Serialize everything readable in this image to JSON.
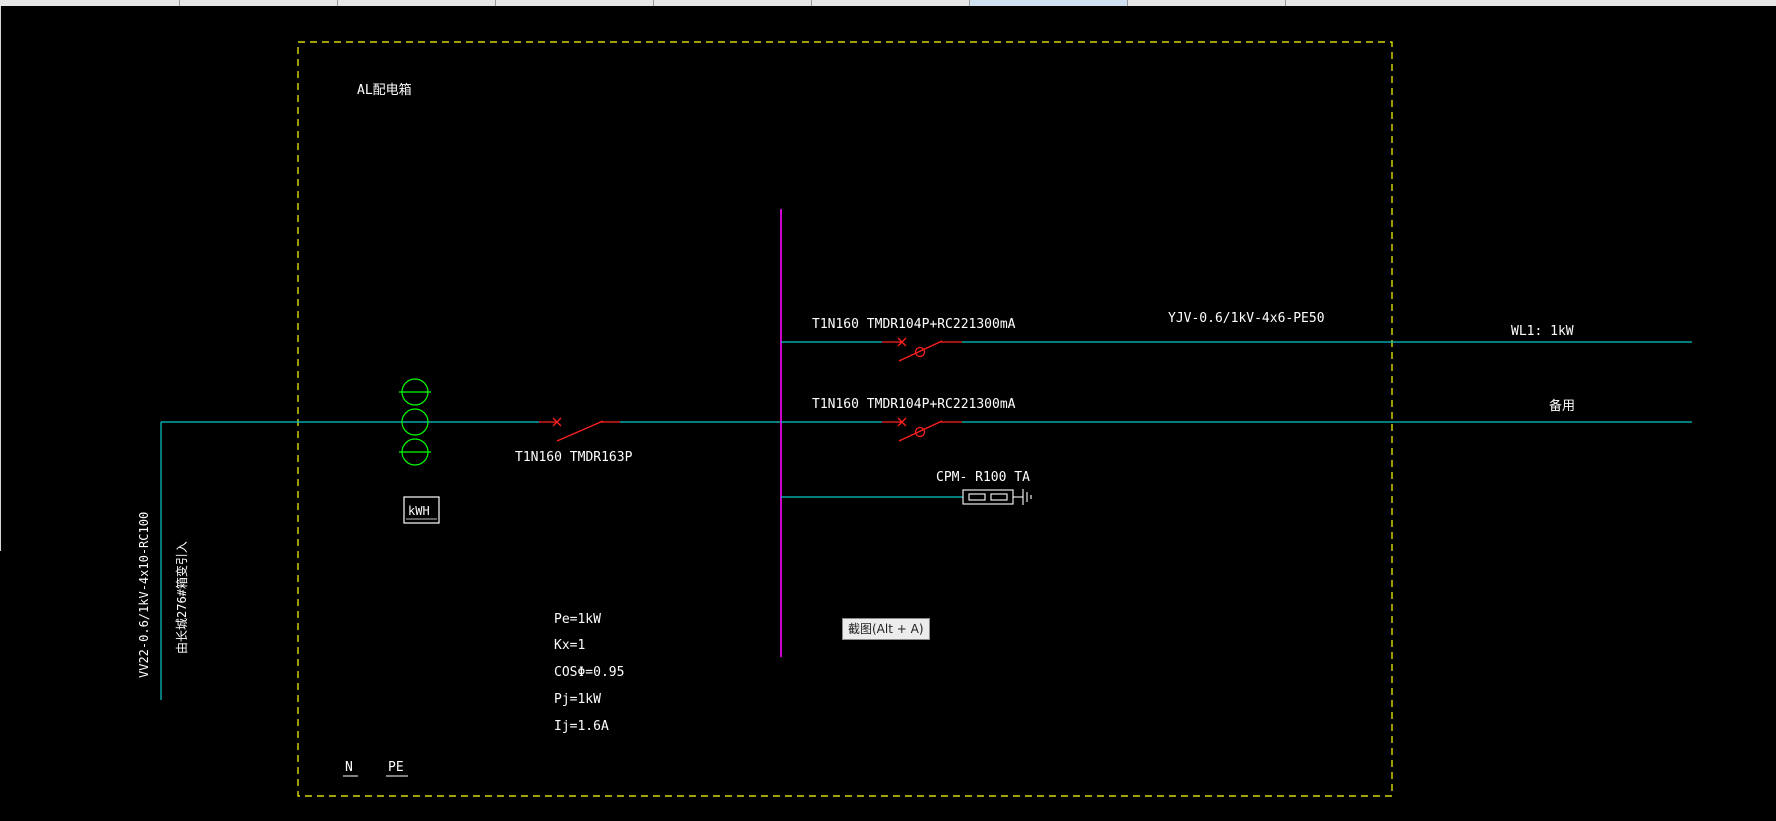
{
  "colors": {
    "background": "#000000",
    "frame": "#ffff00",
    "busbar": "#cc00cc",
    "line": "#00c8c8",
    "breaker": "#ff2020",
    "meter": "#00ff00",
    "text": "#ffffff"
  },
  "diagram": {
    "panel_title": "AL配电箱",
    "incoming": {
      "cable_label": "VV22-0.6/1kV-4x10-RC100",
      "source_label": "由长城276#箱变引入",
      "main_breaker_label": "T1N160 TMDR163P",
      "meter_label": "kWH"
    },
    "load_calc": {
      "pe": "Pe=1kW",
      "kx": "Kx=1",
      "cos": "COSΦ=0.95",
      "pj": "Pj=1kW",
      "ij": "Ij=1.6A"
    },
    "feeders": [
      {
        "breaker_label": "T1N160 TMDR104P+RC221300mA",
        "cable_label": "YJV-0.6/1kV-4x6-PE50",
        "circuit_label": "WL1: 1kW"
      },
      {
        "breaker_label": "T1N160 TMDR104P+RC221300mA",
        "circuit_label": "备用"
      }
    ],
    "spd": {
      "label": "CPM- R100 TA"
    },
    "bus_labels": {
      "n": "N",
      "pe": "PE"
    }
  },
  "tooltip": {
    "text": "截图(Alt + A)"
  }
}
